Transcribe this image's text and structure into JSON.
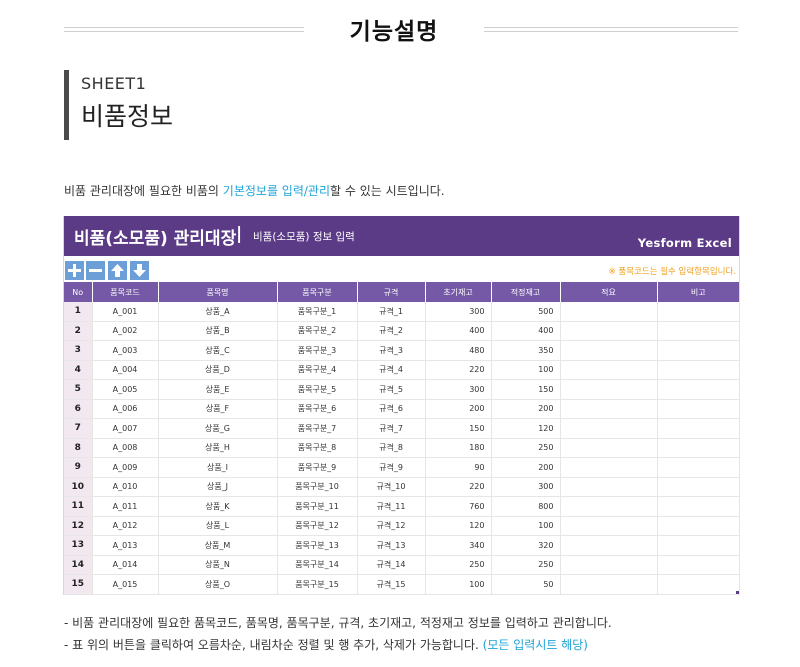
{
  "header": {
    "title": "기능설명"
  },
  "sheet": {
    "label": "SHEET1",
    "name": "비품정보"
  },
  "description": {
    "pre": "비품 관리대장에 필요한 비품의 ",
    "highlight": "기본정보를 입력/관리",
    "post": "할 수 있는 시트입니다."
  },
  "banner": {
    "title": "비품(소모품) 관리대장",
    "separator": "|",
    "subtitle": "비품(소모품) 정보 입력",
    "brand": "Yesform Excel"
  },
  "toolbar": {
    "note": "※ 품목코드는 필수 입력항목입니다."
  },
  "table": {
    "columns": [
      "No",
      "품목코드",
      "품목명",
      "품목구분",
      "규격",
      "초기재고",
      "적정재고",
      "적요",
      "비고"
    ],
    "rows": [
      [
        "1",
        "A_001",
        "상품_A",
        "품목구분_1",
        "규격_1",
        "300",
        "500",
        "",
        ""
      ],
      [
        "2",
        "A_002",
        "상품_B",
        "품목구분_2",
        "규격_2",
        "400",
        "400",
        "",
        ""
      ],
      [
        "3",
        "A_003",
        "상품_C",
        "품목구분_3",
        "규격_3",
        "480",
        "350",
        "",
        ""
      ],
      [
        "4",
        "A_004",
        "상품_D",
        "품목구분_4",
        "규격_4",
        "220",
        "100",
        "",
        ""
      ],
      [
        "5",
        "A_005",
        "상품_E",
        "품목구분_5",
        "규격_5",
        "300",
        "150",
        "",
        ""
      ],
      [
        "6",
        "A_006",
        "상품_F",
        "품목구분_6",
        "규격_6",
        "200",
        "200",
        "",
        ""
      ],
      [
        "7",
        "A_007",
        "상품_G",
        "품목구분_7",
        "규격_7",
        "150",
        "120",
        "",
        ""
      ],
      [
        "8",
        "A_008",
        "상품_H",
        "품목구분_8",
        "규격_8",
        "180",
        "250",
        "",
        ""
      ],
      [
        "9",
        "A_009",
        "상품_I",
        "품목구분_9",
        "규격_9",
        "90",
        "200",
        "",
        ""
      ],
      [
        "10",
        "A_010",
        "상품_J",
        "품목구분_10",
        "규격_10",
        "220",
        "300",
        "",
        ""
      ],
      [
        "11",
        "A_011",
        "상품_K",
        "품목구분_11",
        "규격_11",
        "760",
        "800",
        "",
        ""
      ],
      [
        "12",
        "A_012",
        "상품_L",
        "품목구분_12",
        "규격_12",
        "120",
        "100",
        "",
        ""
      ],
      [
        "13",
        "A_013",
        "상품_M",
        "품목구분_13",
        "규격_13",
        "340",
        "320",
        "",
        ""
      ],
      [
        "14",
        "A_014",
        "상품_N",
        "품목구분_14",
        "규격_14",
        "250",
        "250",
        "",
        ""
      ],
      [
        "15",
        "A_015",
        "상품_O",
        "품목구분_15",
        "규격_15",
        "100",
        "50",
        "",
        ""
      ]
    ]
  },
  "footer": {
    "line1": "- 비품 관리대장에 필요한 품목코드, 품목명, 품목구분, 규격, 초기재고, 적정재고 정보를 입력하고 관리합니다.",
    "line2": "- 표 위의 버튼을 클릭하여 오름차순, 내림차순 정렬 및 행 추가, 삭제가 가능합니다. ",
    "line2_highlight": "(모든 입력시트 해당)"
  },
  "colors": {
    "banner": "#5b3a86",
    "header_row": "#7659a6",
    "button": "#6c9ed8",
    "highlight": "#1fa3d8",
    "note": "#f0a020"
  },
  "icons": {
    "add": "plus-icon",
    "remove": "minus-icon",
    "sort_asc": "arrow-up-icon",
    "sort_desc": "arrow-down-icon"
  }
}
